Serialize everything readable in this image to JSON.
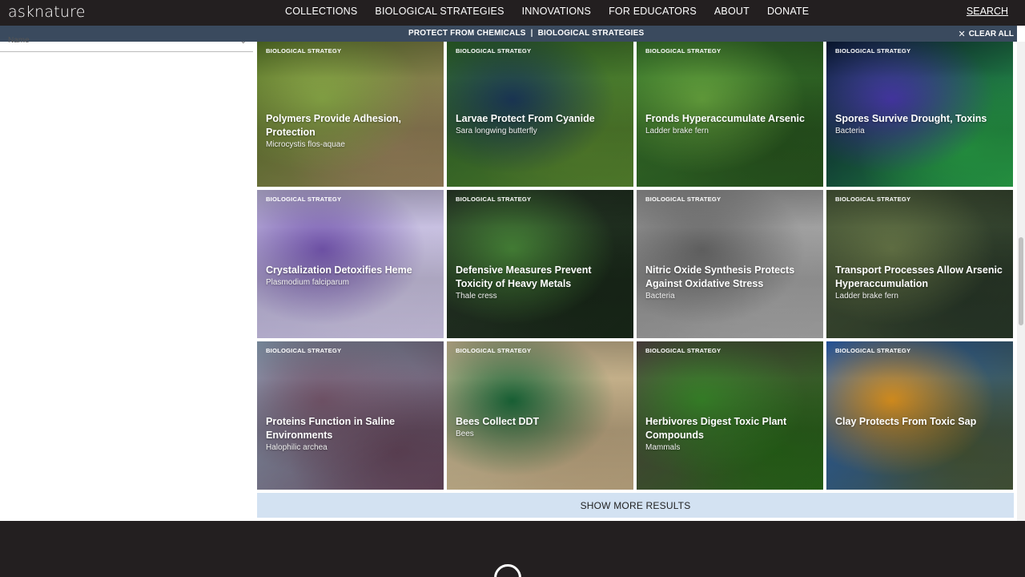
{
  "header": {
    "logo": "asknature",
    "nav": [
      "COLLECTIONS",
      "BIOLOGICAL STRATEGIES",
      "INNOVATIONS",
      "FOR EDUCATORS",
      "ABOUT",
      "DONATE"
    ],
    "search": "SEARCH"
  },
  "filterbar": {
    "filters": [
      "PROTECT FROM CHEMICALS",
      "BIOLOGICAL STRATEGIES"
    ],
    "separator": "|",
    "clear_all": "CLEAR ALL"
  },
  "sidebar": {
    "clipped_label": "Name"
  },
  "cards": [
    {
      "tag": "BIOLOGICAL STRATEGY",
      "title": "Polymers Provide Adhesion, Protection",
      "subtitle": "Microcystis flos-aquae",
      "colors": [
        "#5c7c2a",
        "#8fb04a",
        "#a08860"
      ]
    },
    {
      "tag": "BIOLOGICAL STRATEGY",
      "title": "Larvae Protect From Cyanide",
      "subtitle": "Sara longwing butterfly",
      "colors": [
        "#2f6a2a",
        "#1c3a5c",
        "#5a8a30"
      ]
    },
    {
      "tag": "BIOLOGICAL STRATEGY",
      "title": "Fronds Hyperaccumulate Arsenic",
      "subtitle": "Ladder brake fern",
      "colors": [
        "#3a7a2e",
        "#6aaa40",
        "#2a5a20"
      ]
    },
    {
      "tag": "BIOLOGICAL STRATEGY",
      "title": "Spores Survive Drought, Toxins",
      "subtitle": "Bacteria",
      "colors": [
        "#0a1a3a",
        "#4a3ab0",
        "#2aa84a"
      ]
    },
    {
      "tag": "BIOLOGICAL STRATEGY",
      "title": "Crystalization Detoxifies Heme",
      "subtitle": "Plasmodium falciparum",
      "colors": [
        "#c8c0e8",
        "#7a5ab8",
        "#d8d0f0"
      ]
    },
    {
      "tag": "BIOLOGICAL STRATEGY",
      "title": "Defensive Measures Prevent Toxicity of Heavy Metals",
      "subtitle": "Thale cress",
      "colors": [
        "#2a3a2a",
        "#4a8a3a",
        "#1a2a1a"
      ]
    },
    {
      "tag": "BIOLOGICAL STRATEGY",
      "title": "Nitric Oxide Synthesis Protects Against Oxidative Stress",
      "subtitle": "Bacteria",
      "colors": [
        "#9a9a9a",
        "#6a6a6a",
        "#b0b0b0"
      ]
    },
    {
      "tag": "BIOLOGICAL STRATEGY",
      "title": "Transport Processes Allow Arsenic Hyperaccumulation",
      "subtitle": "Ladder brake fern",
      "colors": [
        "#4a5a3a",
        "#6a7a4a",
        "#2a3a2a"
      ]
    },
    {
      "tag": "BIOLOGICAL STRATEGY",
      "title": "Proteins Function in Saline Environments",
      "subtitle": "Halophilic archea",
      "colors": [
        "#9ab0c8",
        "#7a5a70",
        "#6a4a60"
      ]
    },
    {
      "tag": "BIOLOGICAL STRATEGY",
      "title": "Bees Collect DDT",
      "subtitle": "Bees",
      "colors": [
        "#d8c8a0",
        "#1a6a3a",
        "#c8b088"
      ]
    },
    {
      "tag": "BIOLOGICAL STRATEGY",
      "title": "Herbivores Digest Toxic Plant Compounds",
      "subtitle": "Mammals",
      "colors": [
        "#5a4a4a",
        "#3a8a2a",
        "#2a6a1a"
      ]
    },
    {
      "tag": "BIOLOGICAL STRATEGY",
      "title": "Clay Protects From Toxic Sap",
      "subtitle": "",
      "colors": [
        "#2a6ac8",
        "#e89a20",
        "#4a5a3a"
      ]
    }
  ],
  "show_more": "SHOW MORE RESULTS"
}
